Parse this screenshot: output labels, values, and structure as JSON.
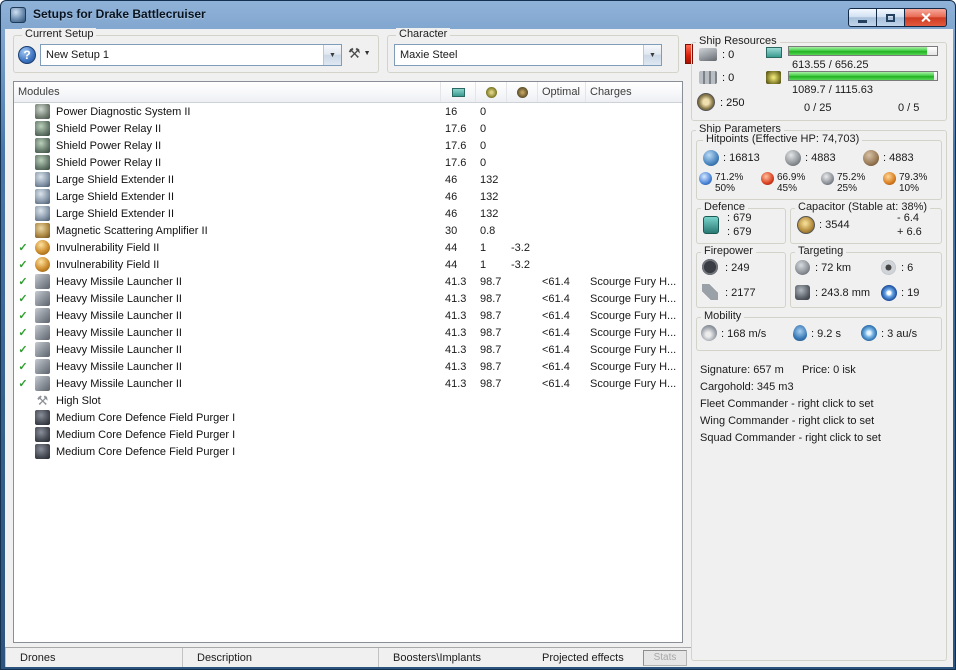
{
  "window": {
    "title": "Setups for Drake Battlecruiser"
  },
  "icons_map": {
    "help": "?",
    "tools": "⚒",
    "dropdown_arrow": "▼",
    "check": "✓"
  },
  "setup": {
    "label": "Current Setup",
    "value": "New Setup 1"
  },
  "character": {
    "label": "Character",
    "value": "Maxie Steel"
  },
  "modules": {
    "title": "Modules",
    "columns": {
      "optimal": "Optimal",
      "charges": "Charges"
    },
    "rows": [
      {
        "check": "",
        "icon": "power-diagnostic",
        "name": "Power Diagnostic System II",
        "cpu": "16",
        "pg": "0",
        "cap": "",
        "optimal": "",
        "charges": ""
      },
      {
        "check": "",
        "icon": "shield-power-relay",
        "name": "Shield Power Relay II",
        "cpu": "17.6",
        "pg": "0",
        "cap": "",
        "optimal": "",
        "charges": ""
      },
      {
        "check": "",
        "icon": "shield-power-relay",
        "name": "Shield Power Relay II",
        "cpu": "17.6",
        "pg": "0",
        "cap": "",
        "optimal": "",
        "charges": ""
      },
      {
        "check": "",
        "icon": "shield-power-relay",
        "name": "Shield Power Relay II",
        "cpu": "17.6",
        "pg": "0",
        "cap": "",
        "optimal": "",
        "charges": ""
      },
      {
        "check": "",
        "icon": "shield-extender",
        "name": "Large Shield Extender II",
        "cpu": "46",
        "pg": "132",
        "cap": "",
        "optimal": "",
        "charges": ""
      },
      {
        "check": "",
        "icon": "shield-extender",
        "name": "Large Shield Extender II",
        "cpu": "46",
        "pg": "132",
        "cap": "",
        "optimal": "",
        "charges": ""
      },
      {
        "check": "",
        "icon": "shield-extender",
        "name": "Large Shield Extender II",
        "cpu": "46",
        "pg": "132",
        "cap": "",
        "optimal": "",
        "charges": ""
      },
      {
        "check": "",
        "icon": "magnetic-amp",
        "name": "Magnetic Scattering Amplifier II",
        "cpu": "30",
        "pg": "0.8",
        "cap": "",
        "optimal": "",
        "charges": ""
      },
      {
        "check": "✓",
        "icon": "invuln-field",
        "name": "Invulnerability Field II",
        "cpu": "44",
        "pg": "1",
        "cap": "-3.2",
        "optimal": "",
        "charges": ""
      },
      {
        "check": "✓",
        "icon": "invuln-field",
        "name": "Invulnerability Field II",
        "cpu": "44",
        "pg": "1",
        "cap": "-3.2",
        "optimal": "",
        "charges": ""
      },
      {
        "check": "✓",
        "icon": "missile-launcher",
        "name": "Heavy Missile Launcher II",
        "cpu": "41.3",
        "pg": "98.7",
        "cap": "",
        "optimal": "<61.4",
        "charges": "Scourge Fury H..."
      },
      {
        "check": "✓",
        "icon": "missile-launcher",
        "name": "Heavy Missile Launcher II",
        "cpu": "41.3",
        "pg": "98.7",
        "cap": "",
        "optimal": "<61.4",
        "charges": "Scourge Fury H..."
      },
      {
        "check": "✓",
        "icon": "missile-launcher",
        "name": "Heavy Missile Launcher II",
        "cpu": "41.3",
        "pg": "98.7",
        "cap": "",
        "optimal": "<61.4",
        "charges": "Scourge Fury H..."
      },
      {
        "check": "✓",
        "icon": "missile-launcher",
        "name": "Heavy Missile Launcher II",
        "cpu": "41.3",
        "pg": "98.7",
        "cap": "",
        "optimal": "<61.4",
        "charges": "Scourge Fury H..."
      },
      {
        "check": "✓",
        "icon": "missile-launcher",
        "name": "Heavy Missile Launcher II",
        "cpu": "41.3",
        "pg": "98.7",
        "cap": "",
        "optimal": "<61.4",
        "charges": "Scourge Fury H..."
      },
      {
        "check": "✓",
        "icon": "missile-launcher",
        "name": "Heavy Missile Launcher II",
        "cpu": "41.3",
        "pg": "98.7",
        "cap": "",
        "optimal": "<61.4",
        "charges": "Scourge Fury H..."
      },
      {
        "check": "✓",
        "icon": "missile-launcher",
        "name": "Heavy Missile Launcher II",
        "cpu": "41.3",
        "pg": "98.7",
        "cap": "",
        "optimal": "<61.4",
        "charges": "Scourge Fury H..."
      },
      {
        "check": "",
        "icon": "high-slot",
        "name": "High Slot",
        "cpu": "",
        "pg": "",
        "cap": "",
        "optimal": "",
        "charges": ""
      },
      {
        "check": "",
        "icon": "rig-purger",
        "name": "Medium Core Defence Field Purger I",
        "cpu": "",
        "pg": "",
        "cap": "",
        "optimal": "",
        "charges": ""
      },
      {
        "check": "",
        "icon": "rig-purger",
        "name": "Medium Core Defence Field Purger I",
        "cpu": "",
        "pg": "",
        "cap": "",
        "optimal": "",
        "charges": ""
      },
      {
        "check": "",
        "icon": "rig-purger",
        "name": "Medium Core Defence Field Purger I",
        "cpu": "",
        "pg": "",
        "cap": "",
        "optimal": "",
        "charges": ""
      }
    ]
  },
  "tabs": [
    {
      "label": "Drones"
    },
    {
      "label": "Description"
    },
    {
      "label": "Boosters\\Implants"
    },
    {
      "label": "Projected effects"
    }
  ],
  "stats_button": "Stats",
  "resources": {
    "label": "Ship Resources",
    "turrets": ": 0",
    "launchers": ": 0",
    "calibration": ": 250",
    "cpu_text": "613.55 / 656.25",
    "cpu_pct": 93.5,
    "pg_text": "1089.7 / 1115.63",
    "pg_pct": 97.7,
    "drone_capacity": "0 / 25",
    "drone_count": "0 / 5"
  },
  "parameters": {
    "label": "Ship Parameters",
    "hitpoints": {
      "label": "Hitpoints (Effective HP: 74,703)",
      "shield": ": 16813",
      "armor": ": 4883",
      "hull": ": 4883",
      "resists": [
        {
          "type": "em",
          "icon": "i-em",
          "shield": "71.2%",
          "armor": "50%"
        },
        {
          "type": "thermal",
          "icon": "i-thermal",
          "shield": "66.9%",
          "armor": "45%"
        },
        {
          "type": "kinetic",
          "icon": "i-kinetic",
          "shield": "75.2%",
          "armor": "25%"
        },
        {
          "type": "explosive",
          "icon": "i-explosive",
          "shield": "79.3%",
          "armor": "10%"
        }
      ]
    },
    "defence": {
      "label": "Defence",
      "shield_recharge": ": 679",
      "passive_rate": ": 679"
    },
    "capacitor": {
      "label": "Capacitor (Stable at: 38%)",
      "amount": ": 3544",
      "usage": "- 6.4",
      "recharge": "+ 6.6"
    },
    "firepower": {
      "label": "Firepower",
      "dps": ": 249",
      "volley": ": 2177"
    },
    "targeting": {
      "label": "Targeting",
      "range": ": 72 km",
      "max_targets": ": 6",
      "scan_resolution": ": 243.8 mm",
      "sensor_strength": ": 19"
    },
    "mobility": {
      "label": "Mobility",
      "speed": ": 168 m/s",
      "align_time": ": 9.2 s",
      "warp_speed": ": 3 au/s"
    },
    "info": {
      "signature": "Signature: 657 m",
      "price": "Price: 0 isk",
      "cargohold": "Cargohold: 345 m3",
      "fleet_commander": "Fleet Commander - right click to set",
      "wing_commander": "Wing Commander - right click to set",
      "squad_commander": "Squad Commander - right click to set"
    }
  }
}
